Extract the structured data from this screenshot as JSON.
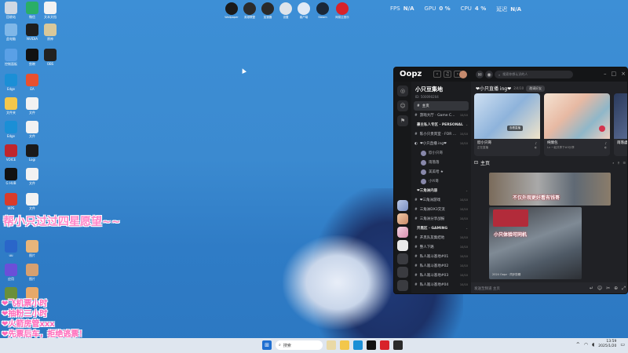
{
  "desktop": {
    "icons": [
      {
        "label": "回收站",
        "icon": "recycle-bin-icon",
        "color": "#cfd8e3"
      },
      {
        "label": "微信",
        "icon": "wechat-icon",
        "color": "#2aae67"
      },
      {
        "label": "文本文档",
        "icon": "document-icon",
        "color": "#f2f2f2"
      },
      {
        "label": "此电脑",
        "icon": "computer-icon",
        "color": "#7fb7e8"
      },
      {
        "label": "NVIDIA",
        "icon": "nvidia-icon",
        "color": "#1e1e1e"
      },
      {
        "label": "原神",
        "icon": "game-icon",
        "color": "#d9c89a"
      },
      {
        "label": "控制面板",
        "icon": "control-panel-icon",
        "color": "#5aa0e6"
      },
      {
        "label": "剪映",
        "icon": "capcut-icon",
        "color": "#111111"
      },
      {
        "label": "OBS",
        "icon": "obs-icon",
        "color": "#222222"
      },
      {
        "label": "Edge",
        "icon": "edge-icon",
        "color": "#1b8fd6"
      },
      {
        "label": "EA",
        "icon": "ea-icon",
        "color": "#e8502e"
      },
      {
        "label": "文件夹",
        "icon": "folder-icon",
        "color": "#f3c74b"
      },
      {
        "label": "文件",
        "icon": "document-icon",
        "color": "#f2f2f2"
      },
      {
        "label": "Edge",
        "icon": "edge-icon",
        "color": "#1b8fd6"
      },
      {
        "label": "文件",
        "icon": "document-icon",
        "color": "#f2f2f2"
      },
      {
        "label": "VOICE",
        "icon": "voice-app-icon",
        "color": "#c0262d"
      },
      {
        "label": "Logi",
        "icon": "logitech-icon",
        "color": "#1a1a1a"
      },
      {
        "label": "G HUB",
        "icon": "ghub-icon",
        "color": "#111111"
      },
      {
        "label": "文件",
        "icon": "document-icon",
        "color": "#f2f2f2"
      },
      {
        "label": "WPS",
        "icon": "wps-icon",
        "color": "#d93b2b"
      },
      {
        "label": "文件",
        "icon": "document-icon",
        "color": "#f2f2f2"
      },
      {
        "label": "uu",
        "icon": "uu-icon",
        "color": "#2a66c9"
      },
      {
        "label": "图片",
        "icon": "image-icon",
        "color": "#e8b57a"
      },
      {
        "label": "应用",
        "icon": "app-icon",
        "color": "#6b4fd8"
      },
      {
        "label": "图片",
        "icon": "image-icon",
        "color": "#d6a070"
      },
      {
        "label": "Minecraft",
        "icon": "minecraft-icon",
        "color": "#6a8f3a"
      },
      {
        "label": "猫",
        "icon": "cat-icon",
        "color": "#e7a96a"
      }
    ],
    "top_apps": [
      {
        "label": "Wallpaper",
        "icon": "wallpaper-icon",
        "color": "#1a1a1a"
      },
      {
        "label": "英雄联盟",
        "icon": "lol-icon",
        "color": "#2b2b2b"
      },
      {
        "label": "加速器",
        "icon": "booster-icon",
        "color": "#2a2a2a"
      },
      {
        "label": "设置",
        "icon": "settings-icon",
        "color": "#dde3ea"
      },
      {
        "label": "客户端",
        "icon": "client-icon",
        "color": "#dfe9f5"
      },
      {
        "label": "Steam",
        "icon": "steam-icon",
        "color": "#1b2838"
      },
      {
        "label": "网易云音乐",
        "icon": "netease-music-icon",
        "color": "#d8232a"
      }
    ]
  },
  "perf": {
    "fps_label": "FPS",
    "fps_value": "N/A",
    "gpu_label": "GPU",
    "gpu_value": "0 %",
    "cpu_label": "CPU",
    "cpu_value": "4 %",
    "latency_label": "延迟",
    "latency_value": "N/A"
  },
  "overlay": {
    "big_text": "帮小只过过四星愿望~~",
    "lines": [
      "❤飞机票小时",
      "❤抽粉三小时",
      "❤火箭房管xxx",
      "❤先票后车，拒绝逃票！"
    ],
    "colors": {
      "text": "#ff66b8",
      "stroke": "#ffffff"
    }
  },
  "app": {
    "logo": "Oopz",
    "search_placeholder": "搜索你想认识的人",
    "server": {
      "name": "小只豆集地",
      "id": "ID: 500090204"
    },
    "channels": [
      {
        "kind": "text",
        "label": "主页",
        "active": true
      },
      {
        "kind": "text",
        "label": "游戏大厅 · Game C...",
        "count": "10/10"
      },
      {
        "kind": "category",
        "label": "豪主私人专区 · PERSONAL"
      },
      {
        "kind": "text",
        "label": "陈小只贵宾室 · FOR ...",
        "count": "10/10"
      },
      {
        "kind": "voice",
        "label": "❤小只直播 ing❤",
        "count": "10/10"
      },
      {
        "kind": "member",
        "label": "欣小只哥"
      },
      {
        "kind": "member",
        "label": "雨落落"
      },
      {
        "kind": "member",
        "label": "美美哈 ★"
      },
      {
        "kind": "member",
        "label": "小Yi哥"
      },
      {
        "kind": "category",
        "label": "❤三角洲内容"
      },
      {
        "kind": "text",
        "label": "❤三角洲游戏",
        "count": "10/10"
      },
      {
        "kind": "text",
        "label": "三角洲DX3交流",
        "count": "10/10"
      },
      {
        "kind": "text",
        "label": "三角洲分享战报",
        "count": "10/10"
      },
      {
        "kind": "category",
        "label": "开黑区 · GAMING"
      },
      {
        "kind": "text",
        "label": "开黑队友集结地",
        "count": "10/10"
      },
      {
        "kind": "text",
        "label": "整人下路",
        "count": "10/10"
      },
      {
        "kind": "text",
        "label": "私人观斗基地#01",
        "count": "10/10"
      },
      {
        "kind": "text",
        "label": "私人观斗基地#02",
        "count": "10/10"
      },
      {
        "kind": "text",
        "label": "私人观斗基地#03",
        "count": "10/10"
      },
      {
        "kind": "text",
        "label": "私人观斗基地#04",
        "count": "10/10"
      }
    ],
    "voice_header": {
      "title": "❤小只直播 ing❤",
      "count": "2/4/10",
      "button": "邀请好友"
    },
    "tiles": [
      {
        "name": "欣小只哥",
        "status": "正在直播",
        "tag": "查看直播"
      },
      {
        "name": "纯情包",
        "status": "Lv 一起共享下#5分享"
      },
      {
        "name": "雨落虞",
        "status": ""
      }
    ],
    "main_title": "主页",
    "post": {
      "caption1": "不仅外观更好看有钱哥",
      "caption2": "小只体验可同机",
      "footer": "2024 Oopz · 同步剪辑"
    },
    "composer_placeholder": "发送至频道 主页"
  },
  "taskbar": {
    "search_placeholder": "搜索",
    "time": "13:59",
    "date": "2025/1/20"
  }
}
